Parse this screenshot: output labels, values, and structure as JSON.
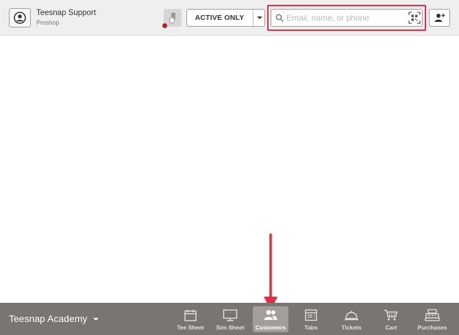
{
  "header": {
    "user_name": "Teesnap Support",
    "user_role": "Proshop",
    "filter_label": "ACTIVE ONLY",
    "search_placeholder": "Email, name, or phone",
    "search_value": ""
  },
  "footer": {
    "academy_name": "Teesnap Academy",
    "nav": [
      {
        "label": "Tee Sheet",
        "icon": "calendar-icon",
        "active": false
      },
      {
        "label": "Sim Sheet",
        "icon": "monitor-icon",
        "active": false
      },
      {
        "label": "Customers",
        "icon": "customers-icon",
        "active": true
      },
      {
        "label": "Tabs",
        "icon": "tabs-icon",
        "active": false
      },
      {
        "label": "Tickets",
        "icon": "service-bell-icon",
        "active": false
      },
      {
        "label": "Cart",
        "icon": "cart-icon",
        "active": false
      },
      {
        "label": "Purchases",
        "icon": "cash-register-icon",
        "active": false
      }
    ]
  },
  "colors": {
    "highlight": "#e8293f",
    "status_dot": "#c0171b",
    "bottom_bar": "#7a7570",
    "active_nav": "#a39e99"
  }
}
